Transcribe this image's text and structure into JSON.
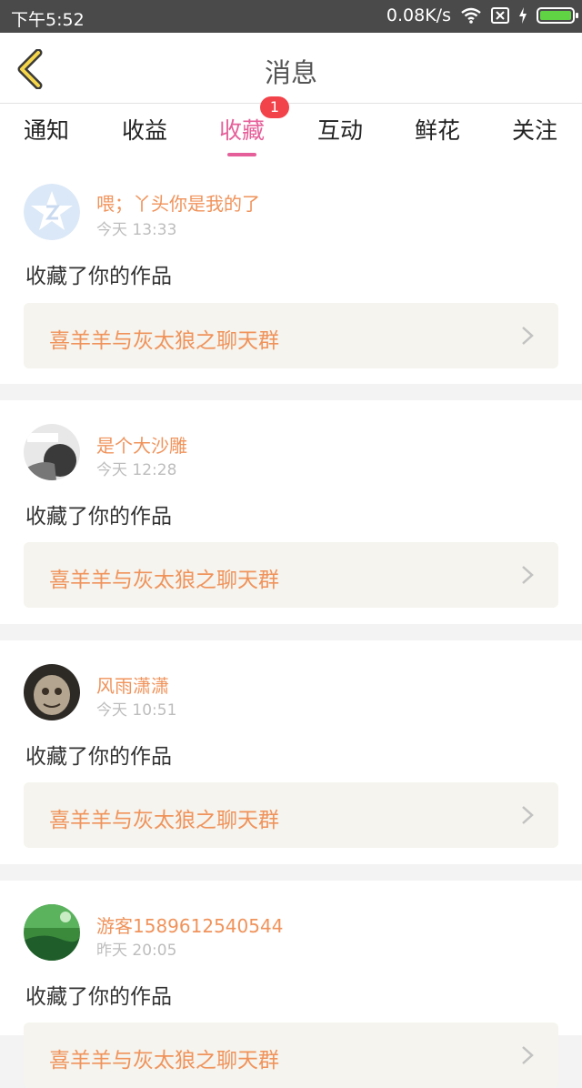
{
  "status": {
    "time": "下午5:52",
    "speed": "0.08K/s"
  },
  "nav": {
    "title": "消息"
  },
  "tabs": [
    {
      "label": "通知"
    },
    {
      "label": "收益"
    },
    {
      "label": "收藏"
    },
    {
      "label": "互动"
    },
    {
      "label": "鲜花"
    },
    {
      "label": "关注"
    }
  ],
  "active_tab": "收藏",
  "badge": "1",
  "messages": [
    {
      "user": "喂；丫头你是我的了",
      "time": "今天 13:33",
      "action": "收藏了你的作品",
      "work": "喜羊羊与灰太狼之聊天群"
    },
    {
      "user": "是个大沙雕",
      "time": "今天 12:28",
      "action": "收藏了你的作品",
      "work": "喜羊羊与灰太狼之聊天群"
    },
    {
      "user": "风雨潇潇",
      "time": "今天 10:51",
      "action": "收藏了你的作品",
      "work": "喜羊羊与灰太狼之聊天群"
    },
    {
      "user": "游客1589612540544",
      "time": "昨天 20:05",
      "action": "收藏了你的作品",
      "work": "喜羊羊与灰太狼之聊天群"
    }
  ],
  "colors": {
    "accent": "#e5609a",
    "username": "#f0935b",
    "badge": "#f2424a"
  }
}
